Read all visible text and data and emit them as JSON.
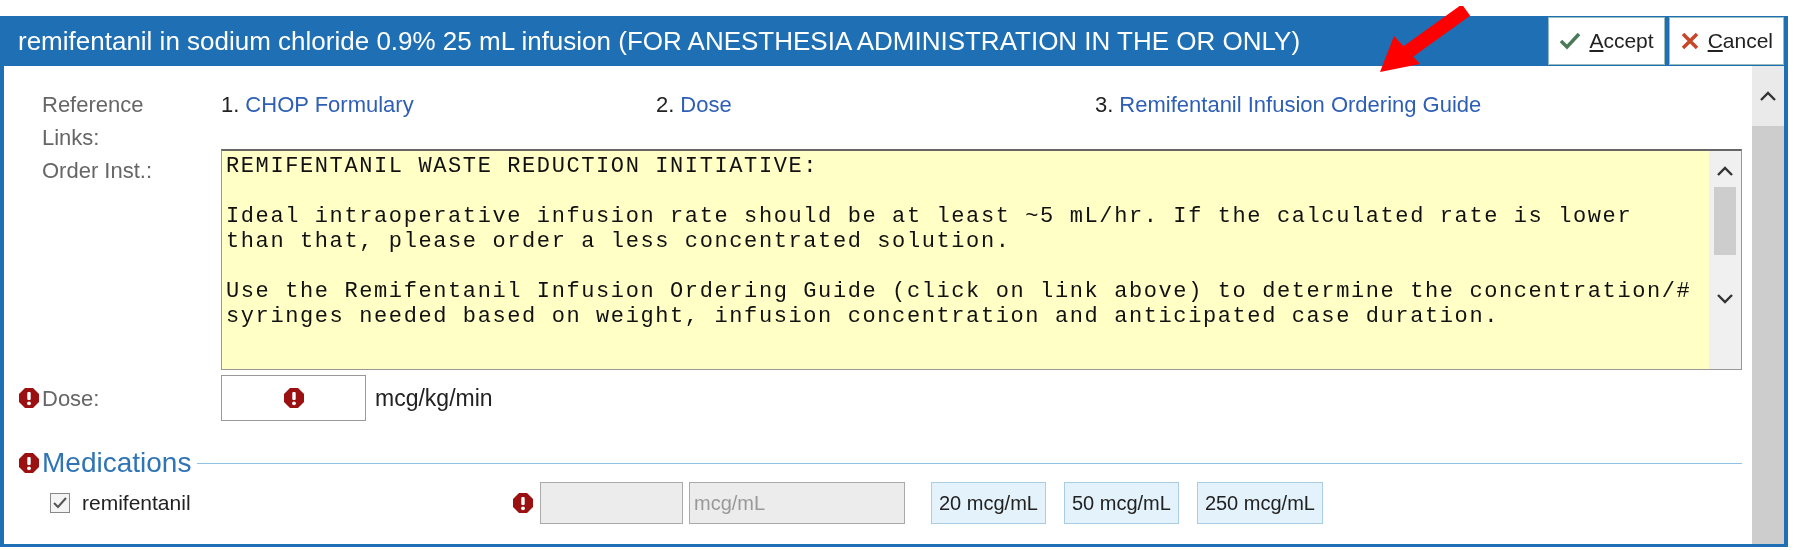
{
  "window": {
    "title": "remifentanil in sodium chloride 0.9% 25 mL infusion (FOR ANESTHESIA ADMINISTRATION IN THE OR ONLY)",
    "buttons": [
      {
        "label": "Accept",
        "kind": "accept"
      },
      {
        "label": "Cancel",
        "kind": "cancel"
      }
    ]
  },
  "reference_links": {
    "label": "Reference Links:",
    "links": [
      {
        "number": "1.",
        "label": "CHOP Formulary"
      },
      {
        "number": "2.",
        "label": "Dose"
      },
      {
        "number": "3.",
        "label": "Remifentanil Infusion Ordering Guide"
      }
    ]
  },
  "order_instructions": {
    "label": "Order Inst.:",
    "text": "REMIFENTANIL WASTE REDUCTION INITIATIVE:\n\nIdeal intraoperative infusion rate should be at least ~5 mL/hr. If the calculated rate is lower\nthan that, please order a less concentrated solution.\n\nUse the Remifentanil Infusion Ordering Guide (click on link above) to determine the concentration/#\nsyringes needed based on weight, infusion concentration and anticipated case duration."
  },
  "dose": {
    "label": "Dose:",
    "required": true,
    "unit": "mcg/kg/min"
  },
  "medications": {
    "title": "Medications",
    "required": true,
    "items": [
      {
        "name": "remifentanil",
        "checked": true,
        "required": true,
        "disabled": true,
        "unit_placeholder": "mcg/mL",
        "presets": [
          "20 mcg/mL",
          "50 mcg/mL",
          "250 mcg/mL"
        ]
      }
    ]
  }
}
